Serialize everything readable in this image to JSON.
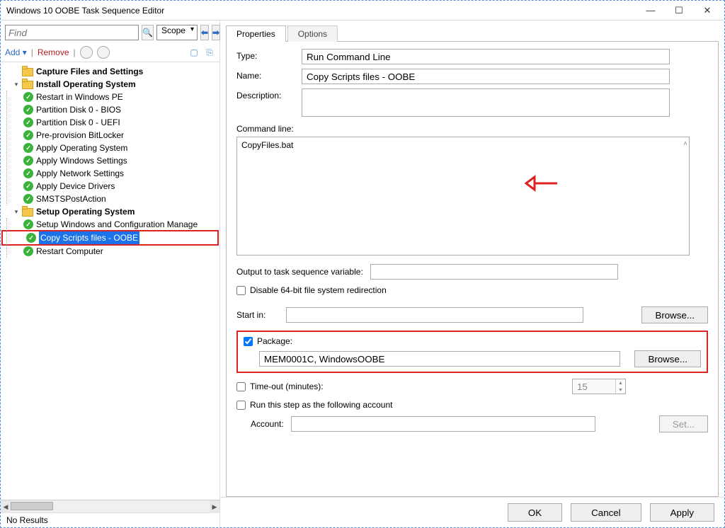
{
  "window": {
    "title": "Windows 10 OOBE Task Sequence Editor"
  },
  "find": {
    "placeholder": "Find",
    "scope_label": "Scope"
  },
  "toolbar": {
    "add": "Add",
    "remove": "Remove"
  },
  "tree": {
    "groups": [
      {
        "label": "Capture Files and Settings",
        "steps": []
      },
      {
        "label": "Install Operating System",
        "steps": [
          "Restart in Windows PE",
          "Partition Disk 0 - BIOS",
          "Partition Disk 0 - UEFI",
          "Pre-provision BitLocker",
          "Apply Operating System",
          "Apply Windows Settings",
          "Apply Network Settings",
          "Apply Device Drivers",
          "SMSTSPostAction"
        ]
      },
      {
        "label": "Setup Operating System",
        "steps": [
          "Setup Windows and Configuration Manage",
          "Copy Scripts files - OOBE",
          "Restart Computer"
        ],
        "selected_index": 1
      }
    ]
  },
  "no_results": "No Results",
  "tabs": {
    "properties": "Properties",
    "options": "Options"
  },
  "form": {
    "type_label": "Type:",
    "type_value": "Run Command Line",
    "name_label": "Name:",
    "name_value": "Copy Scripts files - OOBE",
    "desc_label": "Description:",
    "desc_value": "",
    "cmd_label": "Command line:",
    "cmd_value": "CopyFiles.bat",
    "output_label": "Output to task sequence variable:",
    "output_value": "",
    "disable64_label": "Disable 64-bit file system redirection",
    "disable64_checked": false,
    "startin_label": "Start in:",
    "startin_value": "",
    "browse": "Browse...",
    "package_label": "Package:",
    "package_checked": true,
    "package_value": "MEM0001C, WindowsOOBE",
    "timeout_label": "Time-out (minutes):",
    "timeout_checked": false,
    "timeout_value": "15",
    "runas_label": "Run this step as the following account",
    "runas_checked": false,
    "account_label": "Account:",
    "account_value": "",
    "set": "Set..."
  },
  "buttons": {
    "ok": "OK",
    "cancel": "Cancel",
    "apply": "Apply"
  }
}
